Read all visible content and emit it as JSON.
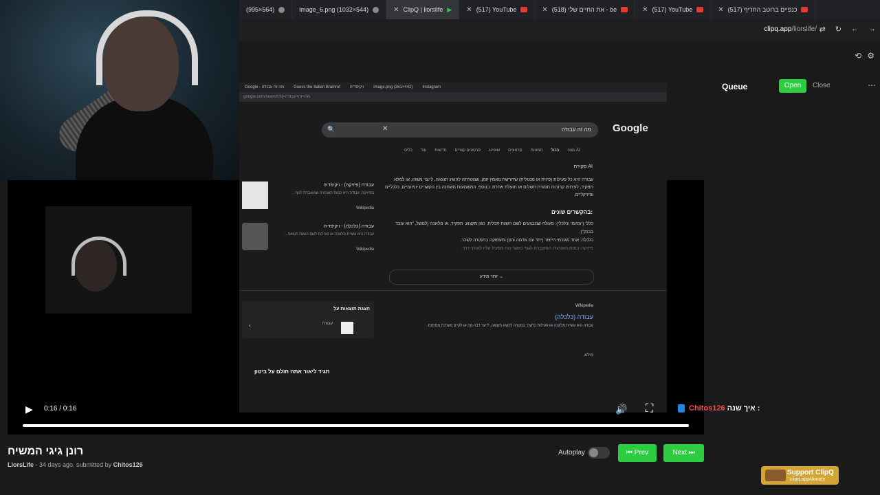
{
  "browser": {
    "tabs": [
      {
        "label": "(995×564)",
        "icon": "globe-icon"
      },
      {
        "label": "image_6.png (1032×544)",
        "icon": "globe-icon"
      },
      {
        "label": "ClipQ | liorslife",
        "icon": "play-icon",
        "active": true
      },
      {
        "label": "(517) YouTube",
        "icon": "youtube-icon"
      },
      {
        "label": "(518) את החיים שלי - be",
        "icon": "youtube-icon"
      },
      {
        "label": "(517) YouTube",
        "icon": "youtube-icon"
      },
      {
        "label": "(517) כנפיים ברוטב החריף",
        "icon": "youtube-icon"
      }
    ],
    "url_domain": "clipq.app",
    "url_path": "/liorslife/"
  },
  "video_content": {
    "google_query": "מה זה עבודה",
    "google_logo": "Google",
    "filters": [
      "מצב AI",
      "הכול",
      "תמונות",
      "סרטונים",
      "שופינג",
      "סרטונים קצרים",
      "חדשות",
      "עוד",
      "כלים"
    ],
    "ai_label": "סקירת AI",
    "ai_paragraph": "עבודה היא כל פעילות (פיזית או מנטלית) שדורשת מאמץ וזמן, שמטרתה להשיג תוצאה, לייצר משהו, או למלא תפקיד, לעיתים קרובות תמורת תשלום או תועלת אחרת. בנוסף, המשמעות משתנה בין הקשרים יומיומיים, כלכליים ופיזיקליים.",
    "contexts_heading": "בהקשרים שונים:",
    "bullets": [
      "כללי (יומיומי וכלכלי): פעולה שמבצעים לשם השגת תכלית, כגון מקצוע, תפקיד, או מלאכה (למשל, \"הוא עובד בבנק\").",
      "כלכלה: אחד מגורמי הייצור (יחד עם אדמה והון) ותעסוקה בתמורה לשכר.",
      "פיזיקה: כמות האנרגיה המועברת לגוף כאשר כוח מפעיל עליו לאורך דרך."
    ],
    "side_cards": [
      {
        "title": "עבודה (פיזיקה) - ויקיפדיה",
        "text": "בפיזיקה, עבודה היא כמות האנרגיה שמועברת לגוף...",
        "source": "Wikipedia"
      },
      {
        "title": "עבודה (כלכלה) - ויקיפדיה",
        "text": "עבודה היא עשיית מלאכה או פעילות לשם השגת תוצאה...",
        "source": "Wikipedia"
      }
    ],
    "more_button": "יותר מידע",
    "results_header": "הצגת תוצאות על",
    "results_item": "עבודה",
    "result1_source": "Wikipedia",
    "result1_title": "עבודה (כלכלה)",
    "result1_desc": "עבודה היא עשיית מלאכה או פעילות כלשהי במטרה להשיג תוצאה, לייצר דבר-מה או לקיים מערכת מסוימת.",
    "result2_source": "מילוג",
    "chat_overlay": "תגיד ליאור אתה חולם על ביטון"
  },
  "player": {
    "time": "0:16 / 0:16",
    "progress": 1.0,
    "chat_username": "Chitos126",
    "chat_message": "איך שנה :"
  },
  "queue": {
    "title": "Queue",
    "open_label": "Open",
    "close_label": "Close",
    "more_icon": "more-icon"
  },
  "clip": {
    "title": "רונן גיגי המשיח",
    "channel": "LiorsLife",
    "meta": " - 34 days ago, submitted by ",
    "submitter": "Chitos126"
  },
  "controls": {
    "autoplay_label": "Autoplay",
    "autoplay_on": false,
    "prev_label": "Prev",
    "next_label": "Next"
  },
  "support": {
    "label": "Support ClipQ",
    "url": "clipq.app/donate"
  },
  "colors": {
    "accent_green": "#2ecc40",
    "chat_user": "#ff4d4d",
    "support_gold": "#d4a437"
  }
}
